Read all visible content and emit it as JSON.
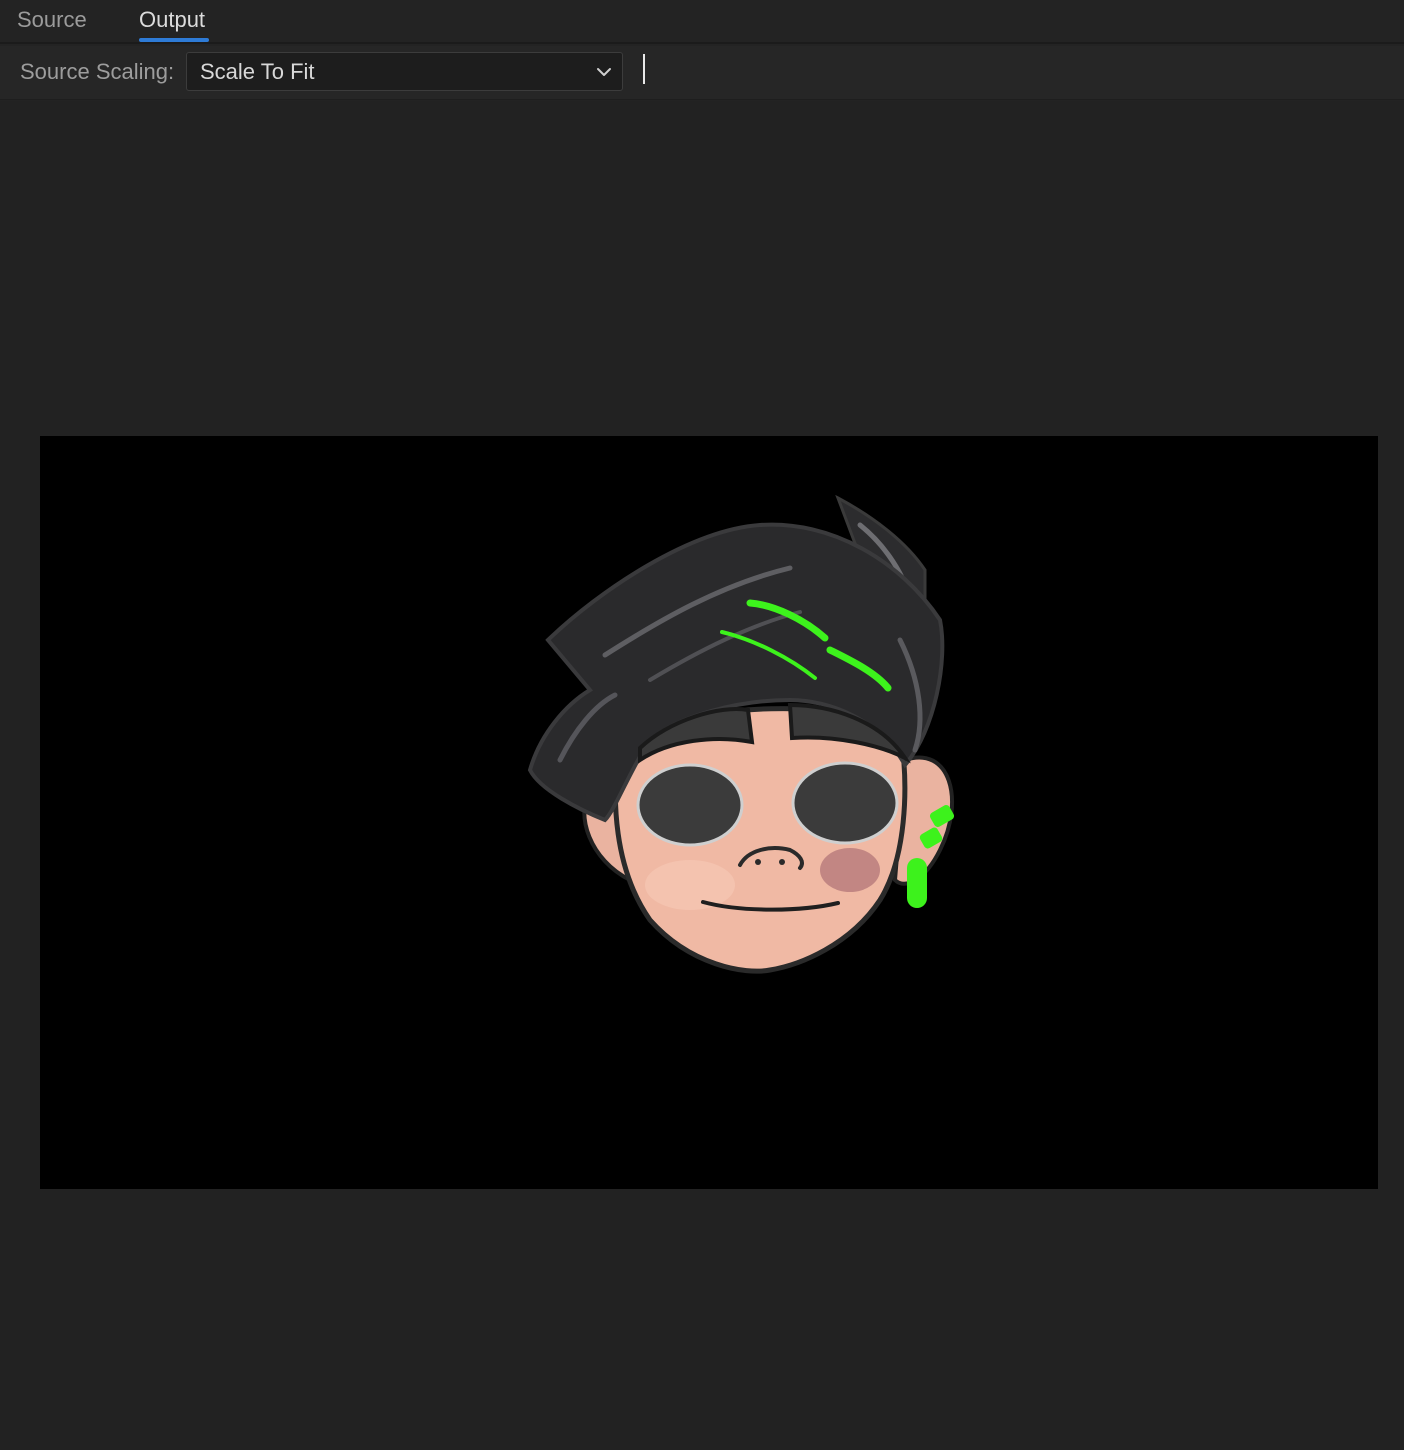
{
  "tabs": [
    {
      "label": "Source",
      "active": false
    },
    {
      "label": "Output",
      "active": true
    }
  ],
  "toolbar": {
    "source_scaling_label": "Source Scaling:",
    "source_scaling_value": "Scale To Fit"
  },
  "colors": {
    "active_tab_underline": "#2e7bd6",
    "frame_background": "#000000",
    "panel_background": "#232323",
    "accent_green": "#3df21c"
  },
  "icons": {
    "dropdown": "chevron-down-icon"
  },
  "preview": {
    "content": "character-head-illustration"
  }
}
